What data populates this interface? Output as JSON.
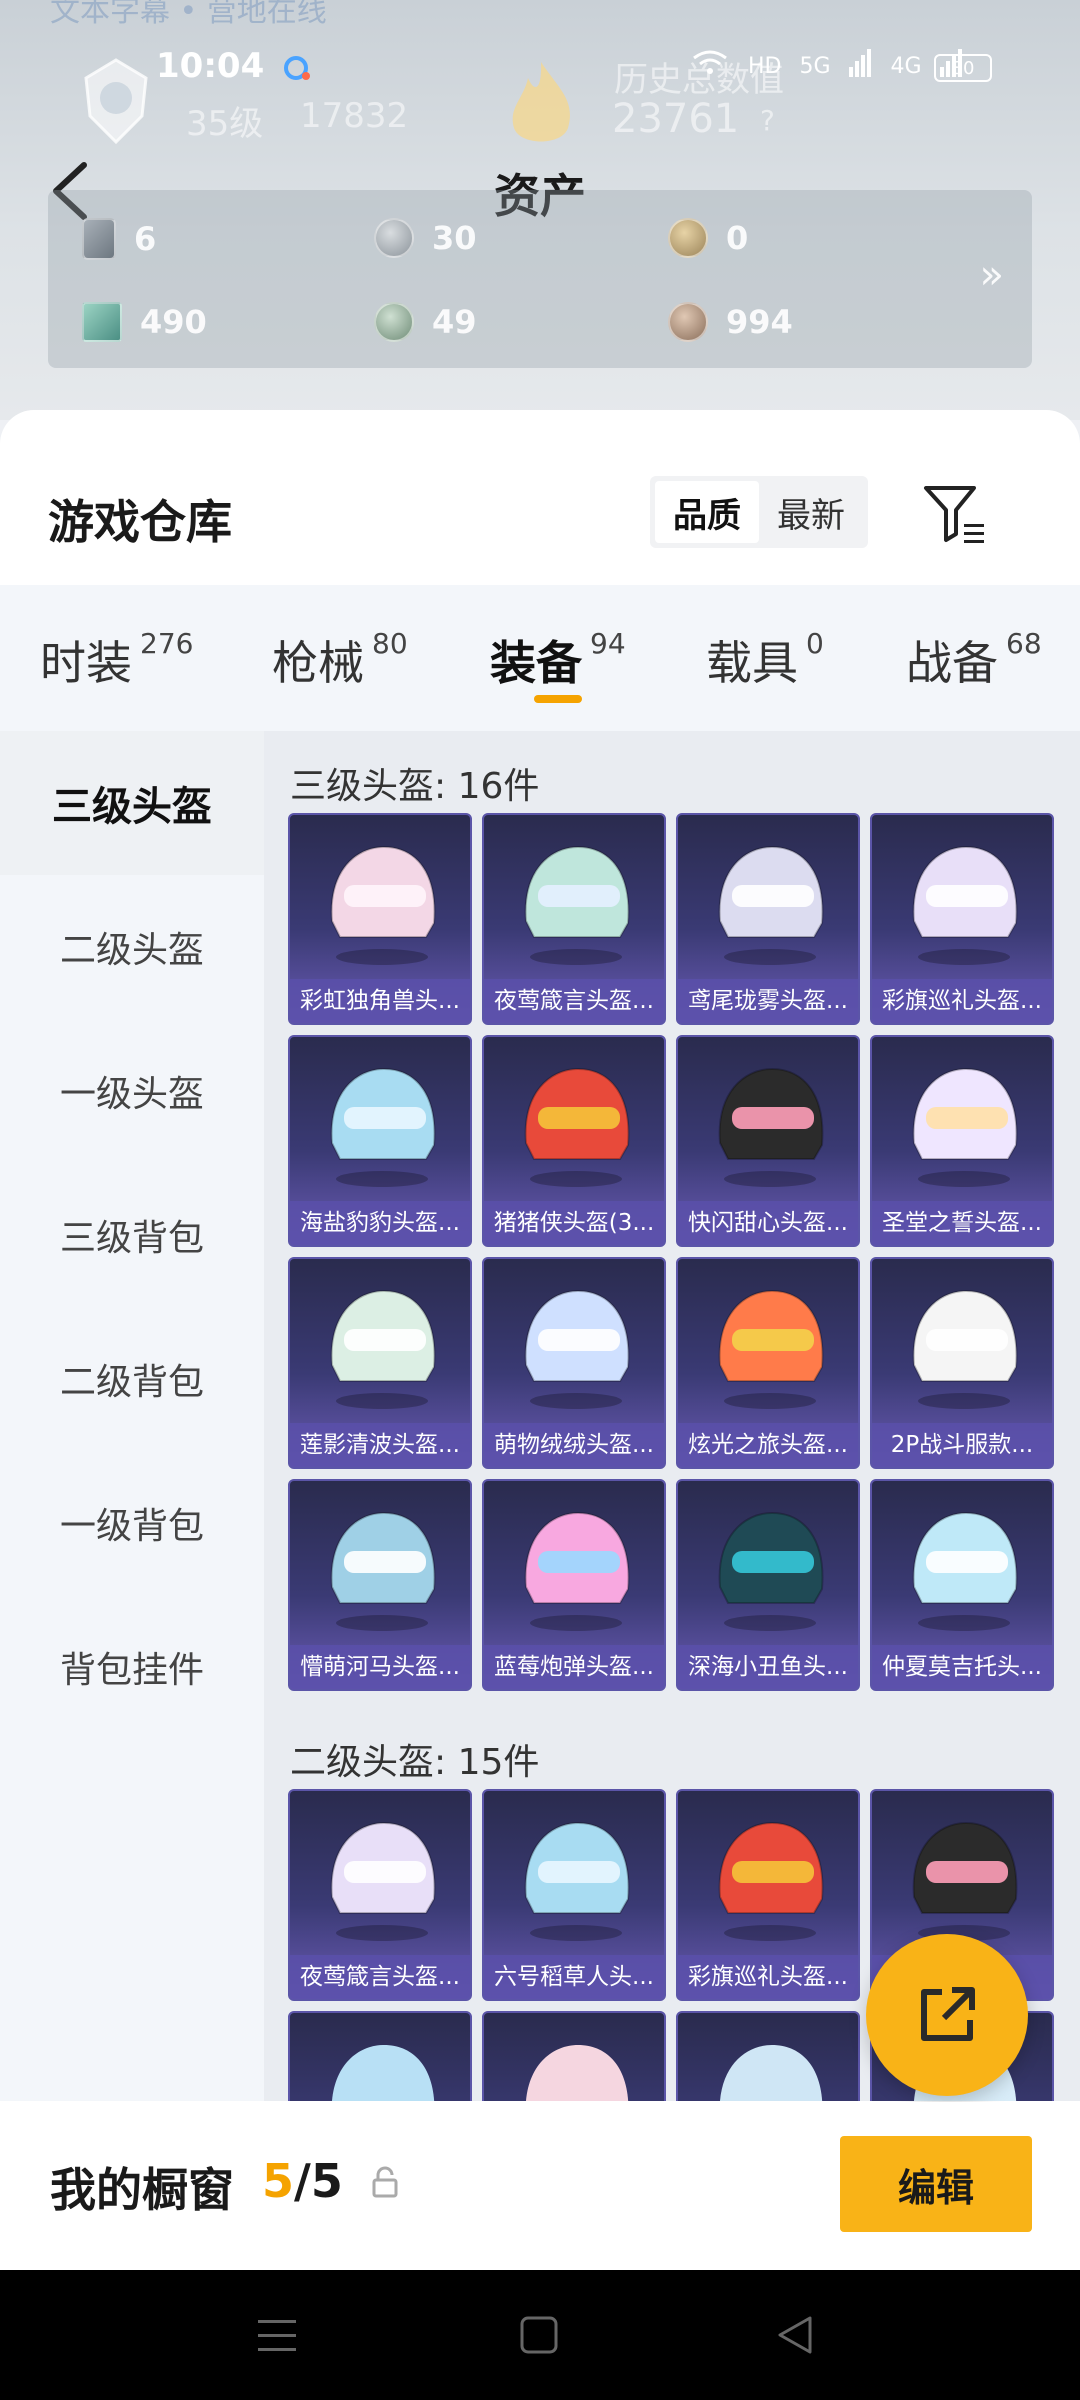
{
  "status_bar": {
    "time": "10:04",
    "signal_5g": "5G",
    "signal_4g": "4G",
    "hd": "HD",
    "battery": "80"
  },
  "header": {
    "title": "资产",
    "faint_link": "文本字幕 • 营地在线",
    "ghost_level": "35级",
    "ghost_points": "17832",
    "ghost_history": "历史总数值",
    "ghost_score": "23761",
    "ghost_question": "?"
  },
  "assets": [
    {
      "icon": "card-icon",
      "value": "6"
    },
    {
      "icon": "silver-coin-icon",
      "value": "30"
    },
    {
      "icon": "gold-coin-icon",
      "value": "0"
    },
    {
      "icon": "ticket-icon",
      "value": "490"
    },
    {
      "icon": "green-coin-icon",
      "value": "49"
    },
    {
      "icon": "bronze-coin-icon",
      "value": "994"
    }
  ],
  "warehouse": {
    "title": "游戏仓库",
    "sort_quality": "品质",
    "sort_latest": "最新"
  },
  "tabs": [
    {
      "label": "时装",
      "count": "276"
    },
    {
      "label": "枪械",
      "count": "80"
    },
    {
      "label": "装备",
      "count": "94"
    },
    {
      "label": "载具",
      "count": "0"
    },
    {
      "label": "战备",
      "count": "68"
    }
  ],
  "sidebar": [
    "三级头盔",
    "二级头盔",
    "一级头盔",
    "三级背包",
    "二级背包",
    "一级背包",
    "背包挂件"
  ],
  "sections": [
    {
      "title": "三级头盔: 16件",
      "items": [
        "彩虹独角兽头...",
        "夜莺箴言头盔...",
        "鸢尾珑雾头盔...",
        "彩旗巡礼头盔...",
        "海盐豹豹头盔...",
        "猪猪侠头盔(3...",
        "快闪甜心头盔...",
        "圣堂之誓头盔...",
        "莲影清波头盔...",
        "萌物绒绒头盔...",
        "炫光之旅头盔...",
        "2P战斗服款...",
        "懵萌河马头盔...",
        "蓝莓炮弹头盔...",
        "深海小丑鱼头...",
        "仲夏莫吉托头..."
      ]
    },
    {
      "title": "二级头盔: 15件",
      "items": [
        "夜莺箴言头盔...",
        "六号稻草人头...",
        "彩旗巡礼头盔...",
        "...头盔..."
      ]
    }
  ],
  "showcase": {
    "label": "我的橱窗",
    "current": "5",
    "separator": "/",
    "total": "5",
    "edit": "编辑"
  },
  "colors": {
    "accent": "#f9b317",
    "tab_underline": "#f5a300",
    "card_bg": "#3a3a74",
    "label_bg": "#5a50aa"
  }
}
